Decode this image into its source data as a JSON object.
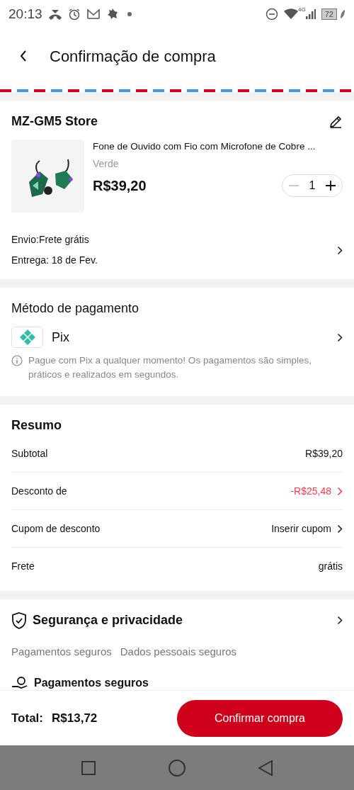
{
  "status_bar": {
    "time": "20:13",
    "network": "4G",
    "battery": "72"
  },
  "header": {
    "title": "Confirmação de compra"
  },
  "store": {
    "name": "MZ-GM5 Store",
    "product": {
      "title": "Fone de Ouvido com Fio com Microfone de Cobre ...",
      "variant": "Verde",
      "price": "R$39,20",
      "quantity": "1"
    },
    "shipping": "Envio:Frete grátis",
    "delivery": "Entrega: 18 de Fev."
  },
  "payment": {
    "title": "Método de pagamento",
    "method": "Pix",
    "note": "Pague com Pix a qualquer momento! Os pagamentos são simples, práticos e realizados em segundos."
  },
  "summary": {
    "title": "Resumo",
    "rows": [
      {
        "kind": "plain",
        "label": "Subtotal",
        "value": "R$39,20"
      },
      {
        "kind": "discount",
        "label": "Desconto de",
        "value": "-R$25,48"
      },
      {
        "kind": "link",
        "label": "Cupom de desconto",
        "value": "Inserir cupom"
      },
      {
        "kind": "plain",
        "label": "Frete",
        "value": "grátis"
      }
    ]
  },
  "security": {
    "title": "Segurança e privacidade",
    "tags": [
      "Pagamentos seguros",
      "Dados pessoais seguros"
    ],
    "subheading": "Pagamentos seguros"
  },
  "footer": {
    "total_label": "Total:",
    "total": "R$13,72",
    "button": "Confirmar compra"
  }
}
